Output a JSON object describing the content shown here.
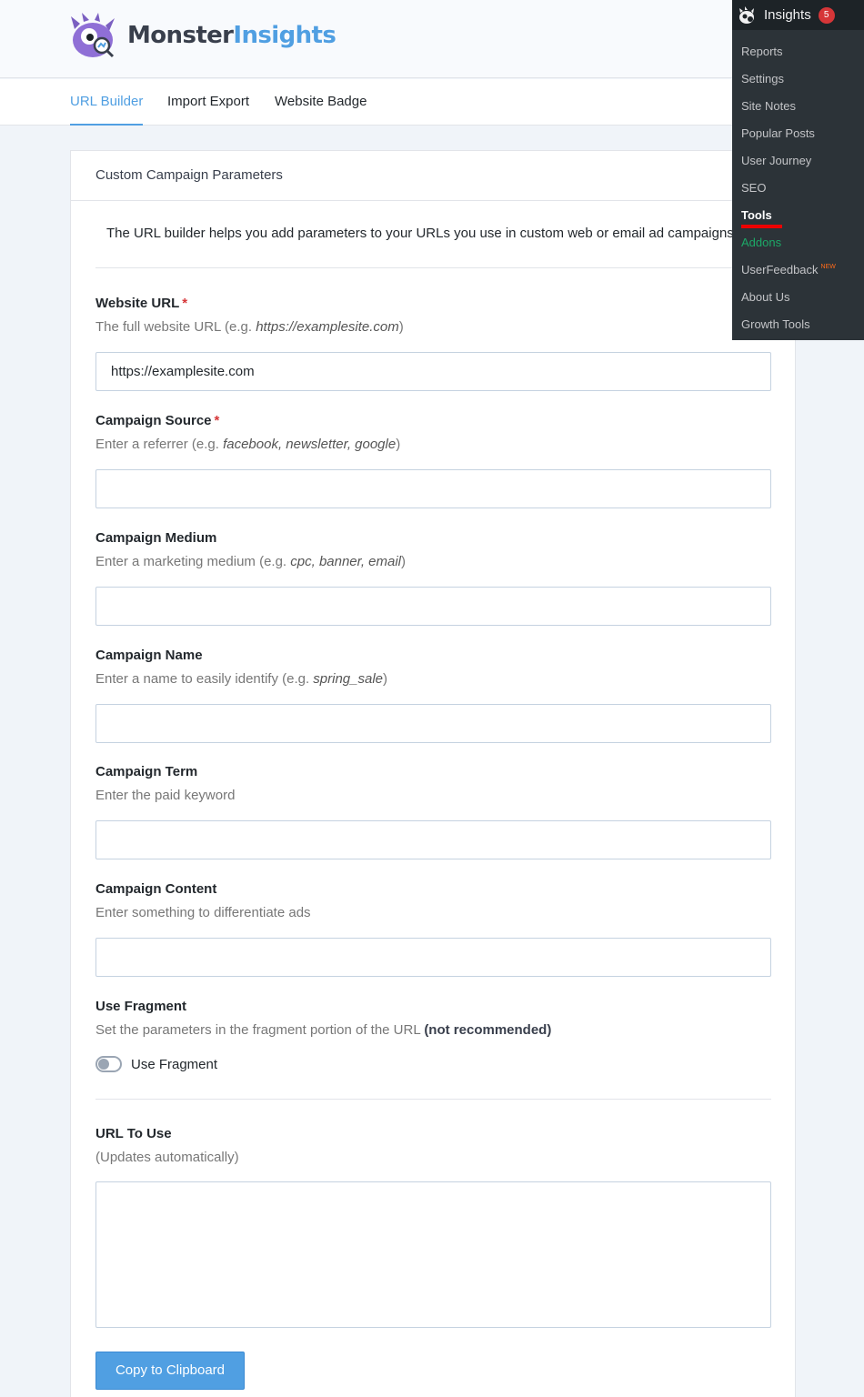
{
  "brand": {
    "name_part1": "Monster",
    "name_part2": "Insights"
  },
  "tabs": [
    {
      "label": "URL Builder",
      "active": true
    },
    {
      "label": "Import Export",
      "active": false
    },
    {
      "label": "Website Badge",
      "active": false
    }
  ],
  "card": {
    "title": "Custom Campaign Parameters",
    "intro": "The URL builder helps you add parameters to your URLs you use in custom web or email ad campaigns."
  },
  "fields": {
    "website_url": {
      "label": "Website URL",
      "required_mark": "*",
      "desc_pre": "The full website URL (e.g. ",
      "desc_em": "https://examplesite.com",
      "desc_post": ")",
      "value": "https://examplesite.com"
    },
    "campaign_source": {
      "label": "Campaign Source",
      "required_mark": "*",
      "desc_pre": "Enter a referrer (e.g. ",
      "desc_em": "facebook, newsletter, google",
      "desc_post": ")",
      "value": ""
    },
    "campaign_medium": {
      "label": "Campaign Medium",
      "desc_pre": "Enter a marketing medium (e.g. ",
      "desc_em": "cpc, banner, email",
      "desc_post": ")",
      "value": ""
    },
    "campaign_name": {
      "label": "Campaign Name",
      "desc_pre": "Enter a name to easily identify (e.g. ",
      "desc_em": "spring_sale",
      "desc_post": ")",
      "value": ""
    },
    "campaign_term": {
      "label": "Campaign Term",
      "desc": "Enter the paid keyword",
      "value": ""
    },
    "campaign_content": {
      "label": "Campaign Content",
      "desc": "Enter something to differentiate ads",
      "value": ""
    }
  },
  "fragment": {
    "label": "Use Fragment",
    "desc_pre": "Set the parameters in the fragment portion of the URL ",
    "desc_bold": "(not recommended)",
    "toggle_label": "Use Fragment",
    "enabled": false
  },
  "url_to_use": {
    "label": "URL To Use",
    "desc": "(Updates automatically)",
    "value": ""
  },
  "copy_button": "Copy to Clipboard",
  "admin_menu": {
    "title": "Insights",
    "badge": "5",
    "new_tag": "NEW",
    "items": [
      {
        "label": "Reports"
      },
      {
        "label": "Settings"
      },
      {
        "label": "Site Notes"
      },
      {
        "label": "Popular Posts"
      },
      {
        "label": "User Journey"
      },
      {
        "label": "SEO"
      },
      {
        "label": "Tools",
        "current": true
      },
      {
        "label": "Addons",
        "highlight": "green"
      },
      {
        "label": "UserFeedback"
      },
      {
        "label": "About Us"
      },
      {
        "label": "Growth Tools"
      }
    ]
  },
  "colors": {
    "accent": "#509fe2",
    "required": "#d63638",
    "admin_bg": "#2c3338",
    "addons_green": "#1da867"
  }
}
